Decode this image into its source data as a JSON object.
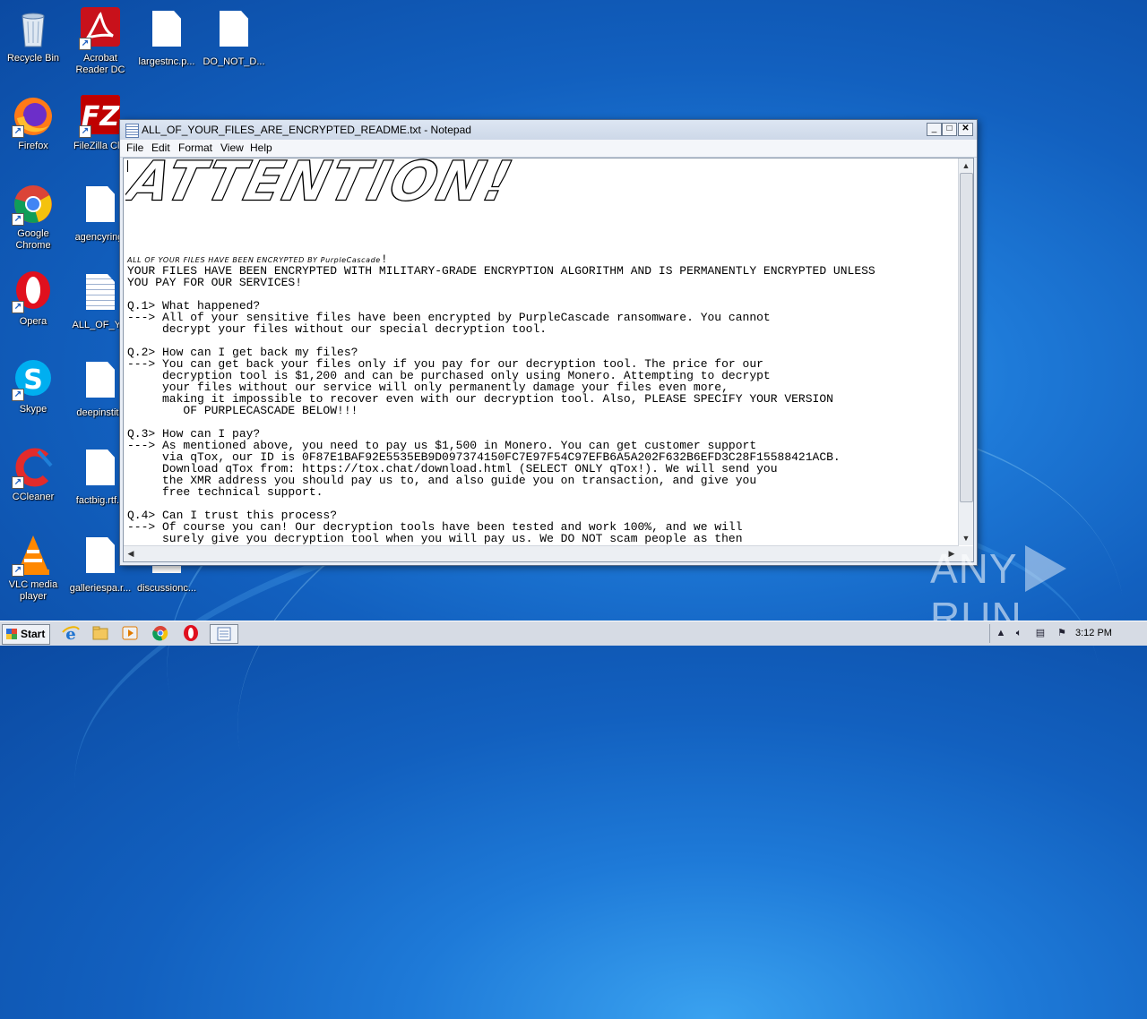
{
  "desktop": {
    "icons": [
      {
        "label": "Recycle Bin",
        "icon": "recycle-bin-icon"
      },
      {
        "label": "Acrobat Reader DC",
        "icon": "acrobat-icon"
      },
      {
        "label": "largestnc.p...",
        "icon": "document-icon"
      },
      {
        "label": "DO_NOT_D...",
        "icon": "document-icon"
      },
      {
        "label": "Firefox",
        "icon": "firefox-icon"
      },
      {
        "label": "FileZilla Clie",
        "icon": "filezilla-icon"
      },
      {
        "label": "Google Chrome",
        "icon": "chrome-icon"
      },
      {
        "label": "agencyringt",
        "icon": "document-icon"
      },
      {
        "label": "Opera",
        "icon": "opera-icon"
      },
      {
        "label": "ALL_OF_YO",
        "icon": "text-file-icon"
      },
      {
        "label": "Skype",
        "icon": "skype-icon"
      },
      {
        "label": "deepinstitu",
        "icon": "document-icon"
      },
      {
        "label": "CCleaner",
        "icon": "ccleaner-icon"
      },
      {
        "label": "factbig.rtf.p",
        "icon": "document-icon"
      },
      {
        "label": "VLC media player",
        "icon": "vlc-icon"
      },
      {
        "label": "galleriespa.r...",
        "icon": "document-icon"
      },
      {
        "label": "discussionc...",
        "icon": "document-icon"
      }
    ]
  },
  "notepad": {
    "title": "ALL_OF_YOUR_FILES_ARE_ENCRYPTED_README.txt - Notepad",
    "menu": [
      "File",
      "Edit",
      "Format",
      "View",
      "Help"
    ],
    "banner": "ATTENTION!",
    "subheading_small": "ALL OF YOUR FILES HAVE BEEN ENCRYPTED BY PurpleCascade",
    "subheading_mark": "!",
    "lines": [
      "YOUR FILES HAVE BEEN ENCRYPTED WITH MILITARY-GRADE ENCRYPTION ALGORITHM AND IS PERMANENTLY ENCRYPTED UNLESS",
      "YOU PAY FOR OUR SERVICES!",
      "",
      "Q.1> What happened?",
      "---> All of your sensitive files have been encrypted by PurpleCascade ransomware. You cannot",
      "     decrypt your files without our special decryption tool.",
      "",
      "Q.2> How can I get back my files?",
      "---> You can get back your files only if you pay for our decryption tool. The price for our",
      "     decryption tool is $1,200 and can be purchased only using Monero. Attempting to decrypt",
      "     your files without our service will only permanently damage your files even more,",
      "     making it impossible to recover even with our decryption tool. Also, PLEASE SPECIFY YOUR VERSION",
      "        OF PURPLECASCADE BELOW!!!",
      "",
      "Q.3> How can I pay?",
      "---> As mentioned above, you need to pay us $1,500 in Monero. You can get customer support",
      "     via qTox, our ID is 0F87E1BAF92E5535EB9D097374150FC7E97F54C97EFB6A5A202F632B6EFD3C28F15588421ACB.",
      "     Download qTox from: https://tox.chat/download.html (SELECT ONLY qTox!). We will send you",
      "     the XMR address you should pay us to, and also guide you on transaction, and give you",
      "     free technical support.",
      "",
      "Q.4> Can I trust this process?",
      "---> Of course you can! Our decryption tools have been tested and work 100%, and we will",
      "     surely give you decryption tool when you will pay us. We DO NOT scam people as then"
    ]
  },
  "taskbar": {
    "start_label": "Start",
    "clock": "3:12 PM"
  },
  "watermark": {
    "left": "ANY",
    "right": "RUN"
  }
}
